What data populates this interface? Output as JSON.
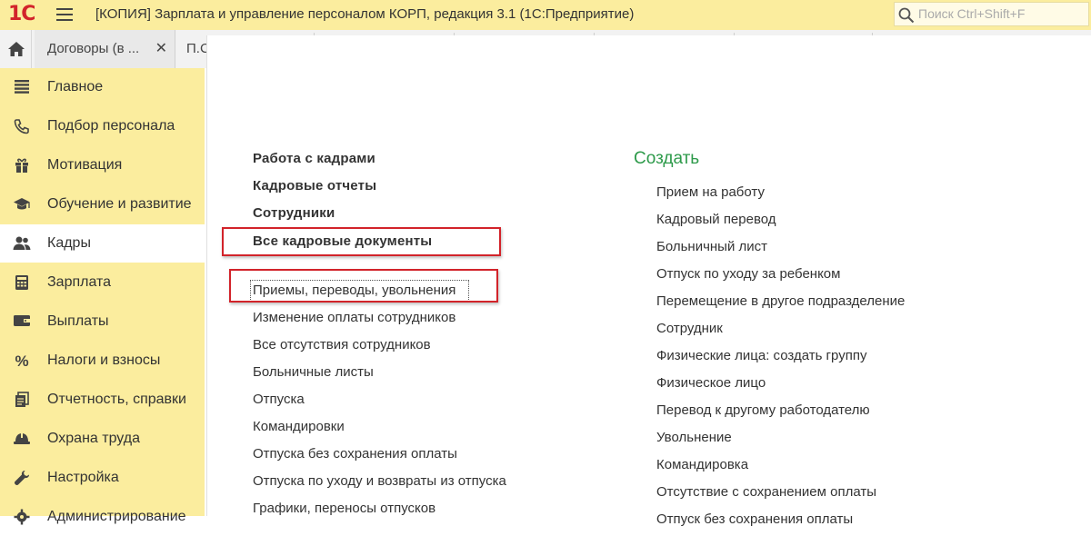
{
  "window": {
    "logo": "1С",
    "title": "[КОПИЯ] Зарплата и управление персоналом КОРП, редакция 3.1  (1С:Предприятие)",
    "search_placeholder": "Поиск Ctrl+Shift+F"
  },
  "tabs": [
    {
      "label": "Договоры (в ..."
    },
    {
      "label": "П.С"
    }
  ],
  "sidebar": {
    "items": [
      {
        "label": "Главное",
        "icon": "menu-lines-icon"
      },
      {
        "label": "Подбор персонала",
        "icon": "phone-icon"
      },
      {
        "label": "Мотивация",
        "icon": "gift-icon"
      },
      {
        "label": "Обучение и развитие",
        "icon": "graduation-cap-icon"
      },
      {
        "label": "Кадры",
        "icon": "people-icon",
        "active": true
      },
      {
        "label": "Зарплата",
        "icon": "calculator-icon"
      },
      {
        "label": "Выплаты",
        "icon": "wallet-icon"
      },
      {
        "label": "Налоги и взносы",
        "icon": "percent-icon"
      },
      {
        "label": "Отчетность, справки",
        "icon": "reports-icon"
      },
      {
        "label": "Охрана труда",
        "icon": "helmet-icon"
      },
      {
        "label": "Настройка",
        "icon": "wrench-icon"
      },
      {
        "label": "Администрирование",
        "icon": "gear-icon"
      }
    ]
  },
  "main": {
    "sections": [
      {
        "label": "Работа с кадрами"
      },
      {
        "label": "Кадровые отчеты"
      },
      {
        "label": "Сотрудники"
      },
      {
        "label": "Все кадровые документы"
      }
    ],
    "links": [
      {
        "label": "Приемы, переводы, увольнения"
      },
      {
        "label": "Изменение оплаты сотрудников"
      },
      {
        "label": "Все отсутствия сотрудников"
      },
      {
        "label": "Больничные листы"
      },
      {
        "label": "Отпуска"
      },
      {
        "label": "Командировки"
      },
      {
        "label": "Отпуска без сохранения оплаты"
      },
      {
        "label": "Отпуска по уходу и возвраты из отпуска"
      },
      {
        "label": "Графики, переносы отпусков"
      }
    ],
    "create": {
      "heading": "Создать",
      "items": [
        {
          "label": "Прием на работу"
        },
        {
          "label": "Кадровый перевод"
        },
        {
          "label": "Больничный лист"
        },
        {
          "label": "Отпуск по уходу за ребенком"
        },
        {
          "label": "Перемещение в другое подразделение"
        },
        {
          "label": "Сотрудник"
        },
        {
          "label": "Физические лица: создать группу"
        },
        {
          "label": "Физическое лицо"
        },
        {
          "label": "Перевод к другому работодателю"
        },
        {
          "label": "Увольнение"
        },
        {
          "label": "Командировка"
        },
        {
          "label": "Отсутствие с сохранением оплаты"
        },
        {
          "label": "Отпуск без сохранения оплаты"
        }
      ]
    }
  },
  "colors": {
    "panel": "#fbed9e",
    "accent_green": "#2d9a4a",
    "highlight_red": "#d2232a",
    "logo_red": "#d2232a"
  }
}
